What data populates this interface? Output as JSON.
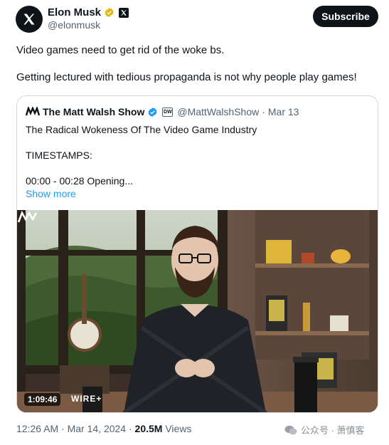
{
  "author": {
    "name": "Elon Musk",
    "handle": "@elonmusk",
    "subscribe_label": "Subscribe"
  },
  "tweet": {
    "line1": "Video games need to get rid of the woke bs.",
    "line2": "Getting lectured with tedious propaganda is not why people play games!"
  },
  "quote": {
    "name": "The Matt Walsh Show",
    "affiliate_badge": "DW",
    "handle": "@MattWalshShow",
    "separator": "·",
    "date": "Mar 13",
    "title": "The Radical Wokeness Of The Video Game Industry",
    "timestamps_label": "TIMESTAMPS:",
    "timestamp_line": "00:00 - 00:28 Opening...",
    "show_more": "Show more",
    "video": {
      "duration": "1:09:46",
      "channel_text": "WIRE+"
    }
  },
  "footer": {
    "time_date": "12:26 AM · Mar 14, 2024 · ",
    "views_count": "20.5M",
    "views_label": " Views"
  },
  "watermark": {
    "text": "公众号 · 萧慎客"
  },
  "colors": {
    "accent": "#1d9bf0",
    "text": "#0f1419",
    "muted": "#536471",
    "border": "#cfd9de",
    "verified_gold": "#e2b719"
  },
  "icons": [
    "x-logo-icon",
    "verified-badge-icon",
    "x-affiliation-icon",
    "matt-walsh-logo-icon",
    "wechat-icon"
  ]
}
